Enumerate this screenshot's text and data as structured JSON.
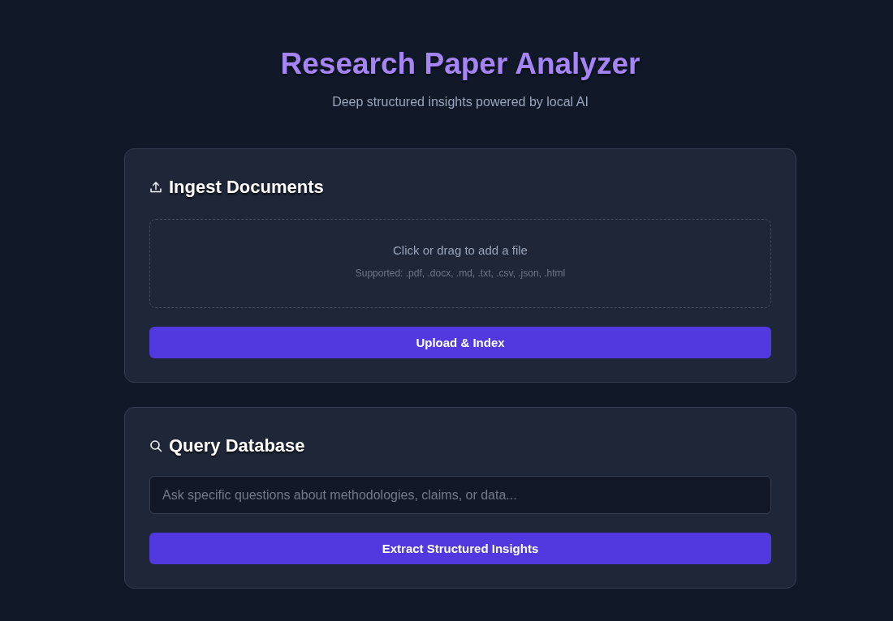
{
  "header": {
    "title": "Research Paper Analyzer",
    "subtitle": "Deep structured insights powered by local AI"
  },
  "cards": [
    {
      "kind": "upload",
      "title": "Ingest Documents",
      "dropzone": {
        "prompt": "Click or drag to add a file",
        "hint": "Supported: .pdf, .docx, .md, .txt, .csv, .json, .html"
      },
      "button": "Upload & Index"
    },
    {
      "kind": "query",
      "title": "Query Database",
      "input": {
        "placeholder": "Ask specific questions about methodologies, claims, or data..."
      },
      "button": "Extract Structured Insights"
    }
  ]
}
